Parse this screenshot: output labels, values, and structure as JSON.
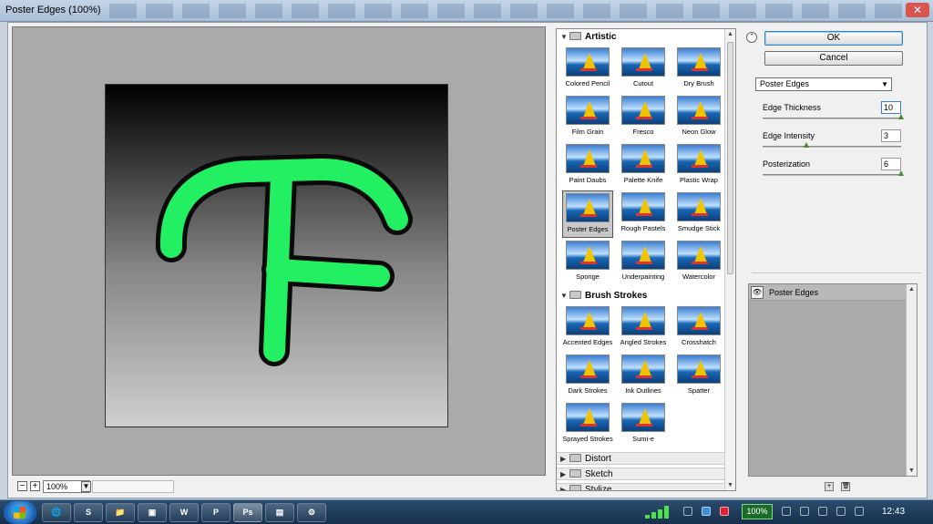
{
  "window": {
    "title": "Poster Edges (100%)",
    "close_glyph": "✕"
  },
  "zoom": {
    "minus": "−",
    "plus": "+",
    "value": "100%",
    "dropdown": "▼"
  },
  "gallery": {
    "categories": [
      {
        "name": "Artistic",
        "expanded": true,
        "filters": [
          "Colored Pencil",
          "Cutout",
          "Dry Brush",
          "Film Grain",
          "Fresco",
          "Neon Glow",
          "Paint Daubs",
          "Palette Knife",
          "Plastic Wrap",
          "Poster Edges",
          "Rough Pastels",
          "Smudge Stick",
          "Sponge",
          "Underpainting",
          "Watercolor"
        ]
      },
      {
        "name": "Brush Strokes",
        "expanded": true,
        "filters": [
          "Accented Edges",
          "Angled Strokes",
          "Crosshatch",
          "Dark Strokes",
          "Ink Outlines",
          "Spatter",
          "Sprayed Strokes",
          "Sumi-e"
        ]
      },
      {
        "name": "Distort",
        "expanded": false
      },
      {
        "name": "Sketch",
        "expanded": false
      },
      {
        "name": "Stylize",
        "expanded": false
      }
    ],
    "selected": "Poster Edges",
    "triangle_open": "▼",
    "triangle_closed": "▶",
    "scroll_up": "▲",
    "scroll_down": "▼"
  },
  "buttons": {
    "ok": "OK",
    "cancel": "Cancel",
    "collapse": "⌃"
  },
  "filter_select": {
    "value": "Poster Edges",
    "arrow": "▼"
  },
  "params": [
    {
      "label": "Edge Thickness",
      "value": "10",
      "fraction": 1.0
    },
    {
      "label": "Edge Intensity",
      "value": "3",
      "fraction": 0.3
    },
    {
      "label": "Posterization",
      "value": "6",
      "fraction": 1.0
    }
  ],
  "layers": {
    "name": "Poster Edges",
    "eye": "👁",
    "scroll_up": "▲",
    "scroll_down": "▼",
    "new": "+",
    "delete": "🗑"
  },
  "taskbar": {
    "apps": [
      {
        "name": "firefox",
        "glyph": "🌐"
      },
      {
        "name": "skype",
        "glyph": "S"
      },
      {
        "name": "folder",
        "glyph": "📁"
      },
      {
        "name": "media",
        "glyph": "▣"
      },
      {
        "name": "word",
        "glyph": "W"
      },
      {
        "name": "powerpoint",
        "glyph": "P"
      },
      {
        "name": "photoshop",
        "glyph": "Ps"
      },
      {
        "name": "app-green",
        "glyph": "▤"
      },
      {
        "name": "app-settings",
        "glyph": "⚙"
      }
    ],
    "battery": "100%",
    "clock": "12:43"
  },
  "colors": {
    "letter_fill": "#22f062",
    "letter_stroke": "#0a0a0a"
  }
}
